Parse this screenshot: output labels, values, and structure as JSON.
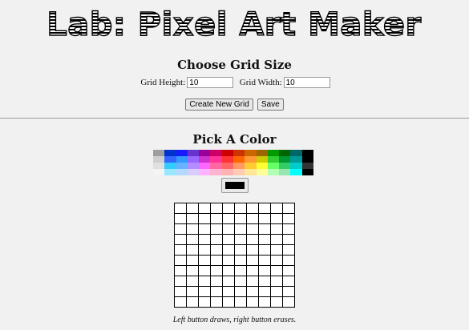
{
  "page_title": "Lab: Pixel Art Maker",
  "grid_size": {
    "heading": "Choose Grid Size",
    "height_label": "Grid Height:",
    "height_value": "10",
    "width_label": "Grid Width:",
    "width_value": "10",
    "create_button": "Create New Grid",
    "save_button": "Save"
  },
  "color": {
    "heading": "Pick A Color",
    "selected_color": "#000000",
    "palette": [
      "#9e9e9e",
      "#0033cc",
      "#1a1aff",
      "#6633cc",
      "#990099",
      "#cc0066",
      "#cc0000",
      "#cc3300",
      "#cc6600",
      "#996600",
      "#009900",
      "#006600",
      "#006666",
      "#000000",
      "#cfcfcf",
      "#3366ff",
      "#3399ff",
      "#9966ff",
      "#cc33cc",
      "#ff3399",
      "#ff3333",
      "#ff6600",
      "#ff9933",
      "#cccc00",
      "#33cc33",
      "#009933",
      "#009999",
      "#000000",
      "#e0e0e0",
      "#33ccff",
      "#66b3ff",
      "#b38cff",
      "#ff66ff",
      "#ff66a3",
      "#ff6666",
      "#ff9966",
      "#ffcc33",
      "#ffff33",
      "#66ff66",
      "#33cc66",
      "#00cccc",
      "#333333",
      "#f4f4f4",
      "#99e6ff",
      "#b3d9ff",
      "#d9ccff",
      "#ffb3ff",
      "#ffb3d1",
      "#ffb3b3",
      "#ffccb3",
      "#ffe699",
      "#ffff99",
      "#b3ffb3",
      "#99e6b3",
      "#00ffff",
      "#000000"
    ]
  },
  "canvas": {
    "rows": 10,
    "cols": 10,
    "cell_color": "#ffffff",
    "line_color": "#000000"
  },
  "hint": "Left button draws, right button erases."
}
